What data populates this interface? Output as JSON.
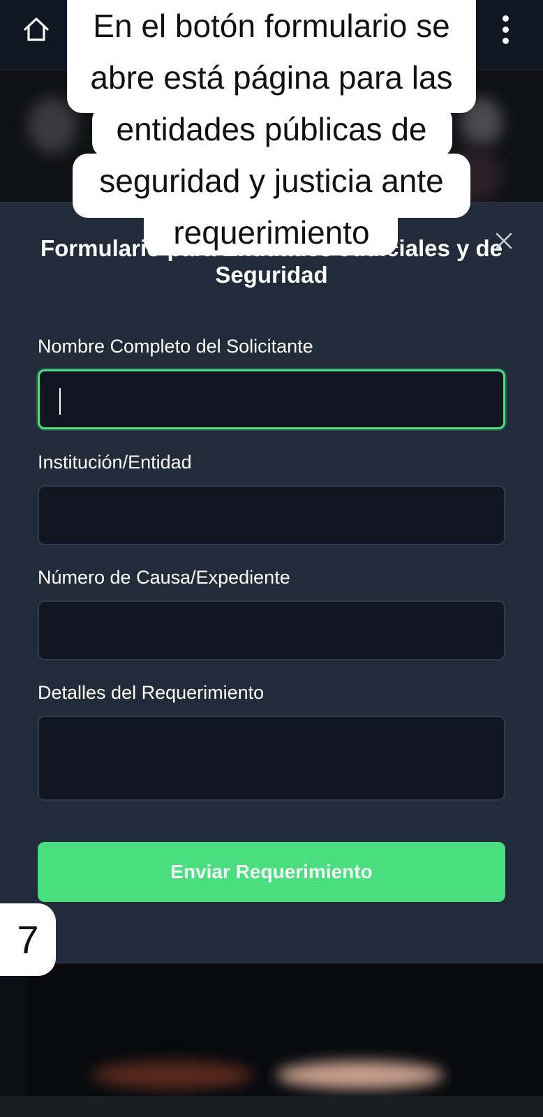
{
  "header": {
    "home_icon": "home-icon",
    "menu_icon": "more-vertical-icon"
  },
  "annotation": {
    "caption": "En el botón formulario se abre está página para las entidades públicas de seguridad y justicia ante requerimiento",
    "step_number": "7"
  },
  "modal": {
    "title": "Formulario para Entidades Judiciales y de Seguridad",
    "close_icon": "close-icon",
    "fields": [
      {
        "label": "Nombre Completo del Solicitante",
        "value": "",
        "focused": true
      },
      {
        "label": "Institución/Entidad",
        "value": ""
      },
      {
        "label": "Número de Causa/Expediente",
        "value": ""
      },
      {
        "label": "Detalles del Requerimiento",
        "value": ""
      }
    ],
    "submit_label": "Enviar Requerimiento"
  },
  "colors": {
    "accent": "#4ade80",
    "modal_bg": "#222b3a",
    "input_bg": "#111722"
  }
}
